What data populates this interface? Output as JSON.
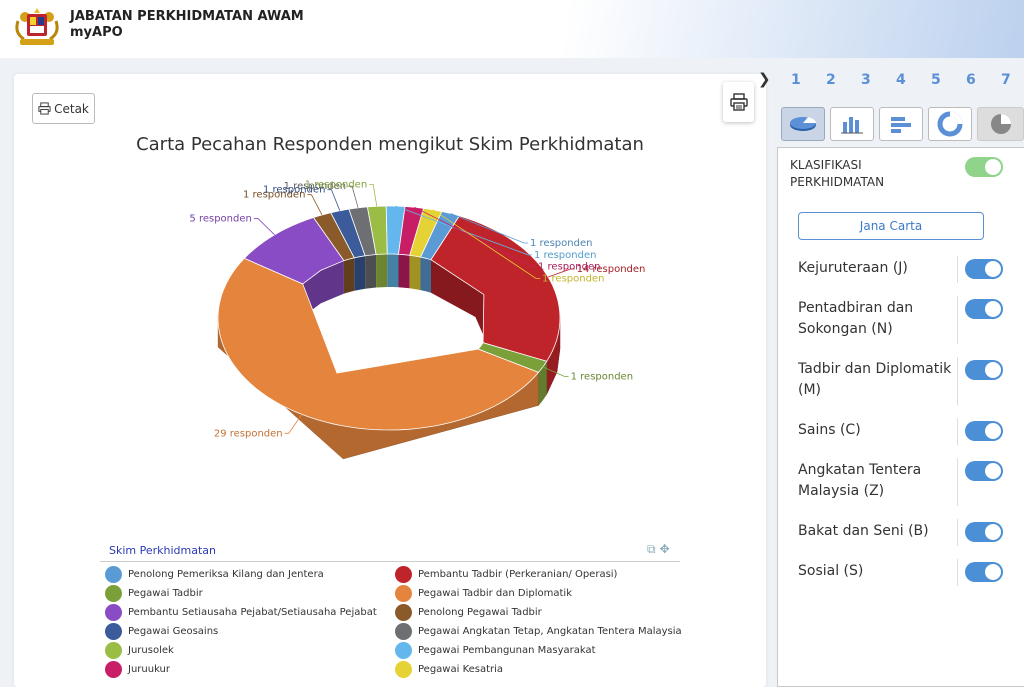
{
  "header": {
    "line1": "JABATAN PERKHIDMATAN AWAM",
    "line2": "myAPO"
  },
  "toolbar": {
    "print_label": "Cetak"
  },
  "chart_title": "Carta Pecahan Responden mengikut Skim Perkhidmatan",
  "pagination": [
    "1",
    "2",
    "3",
    "4",
    "5",
    "6",
    "7"
  ],
  "legend_title": "Skim Perkhidmatan",
  "chart_data": {
    "type": "pie",
    "variant": "donut-3d",
    "title": "Carta Pecahan Responden mengikut Skim Perkhidmatan",
    "series": [
      {
        "name": "Penolong Pemeriksa Kilang dan Jentera",
        "value": 1,
        "color": "#5b9bd5",
        "label": "1 responden"
      },
      {
        "name": "Pembantu Tadbir (Perkeranian/ Operasi)",
        "value": 14,
        "color": "#c0242b",
        "label": "14 responden"
      },
      {
        "name": "Pegawai Tadbir",
        "value": 1,
        "color": "#7ba03a",
        "label": "1 responden"
      },
      {
        "name": "Pegawai Tadbir dan Diplomatik",
        "value": 29,
        "color": "#e5853d",
        "label": "29 responden"
      },
      {
        "name": "Pembantu Setiausaha Pejabat/Setiausaha Pejabat",
        "value": 5,
        "color": "#8a4cc4",
        "label": "5 responden"
      },
      {
        "name": "Penolong Pegawai Tadbir",
        "value": 1,
        "color": "#8b5a2b",
        "label": "1 responden"
      },
      {
        "name": "Pegawai Geosains",
        "value": 1,
        "color": "#3b5b9b",
        "label": "1 responden"
      },
      {
        "name": "Pegawai Angkatan Tetap, Angkatan Tentera Malaysia",
        "value": 1,
        "color": "#6d6f72",
        "label": "1 responden"
      },
      {
        "name": "Jurusolek",
        "value": 1,
        "color": "#9cbd45",
        "label": "1 responden"
      },
      {
        "name": "Pegawai Pembangunan Masyarakat",
        "value": 1,
        "color": "#63b7ec",
        "label": "1 responden"
      },
      {
        "name": "Juruukur",
        "value": 1,
        "color": "#c81e66",
        "label": "1 responden"
      },
      {
        "name": "Pegawai Kesatria",
        "value": 1,
        "color": "#e5d234",
        "label": "1 responden"
      }
    ],
    "legend_columns": [
      [
        "Penolong Pemeriksa Kilang dan Jentera",
        "Pegawai Tadbir",
        "Pembantu Setiausaha Pejabat/Setiausaha Pejabat",
        "Pegawai Geosains",
        "Jurusolek",
        "Juruukur"
      ],
      [
        "Pembantu Tadbir (Perkeranian/ Operasi)",
        "Pegawai Tadbir dan Diplomatik",
        "Penolong Pegawai Tadbir",
        "Pegawai Angkatan Tetap, Angkatan Tentera Malaysia",
        "Pegawai Pembangunan Masyarakat",
        "Pegawai Kesatria"
      ]
    ]
  },
  "panel": {
    "classification_label": "KLASIFIKASI PERKHIDMATAN",
    "classification_on": true,
    "generate_label": "Jana Carta",
    "options": [
      {
        "label": "Kejuruteraan (J)",
        "on": true
      },
      {
        "label": "Pentadbiran dan Sokongan (N)",
        "on": true
      },
      {
        "label": "Tadbir dan Diplomatik (M)",
        "on": true
      },
      {
        "label": "Sains (C)",
        "on": true
      },
      {
        "label": "Angkatan Tentera Malaysia (Z)",
        "on": true
      },
      {
        "label": "Bakat dan Seni (B)",
        "on": true
      },
      {
        "label": "Sosial (S)",
        "on": true
      }
    ]
  },
  "chart_type_buttons": [
    "pie-3d-icon",
    "bar-chart-icon",
    "horizontal-bar-icon",
    "donut-icon",
    "pie-icon"
  ],
  "colors": {
    "accent": "#4b8fd6",
    "toggle_green": "#8fd48a"
  }
}
